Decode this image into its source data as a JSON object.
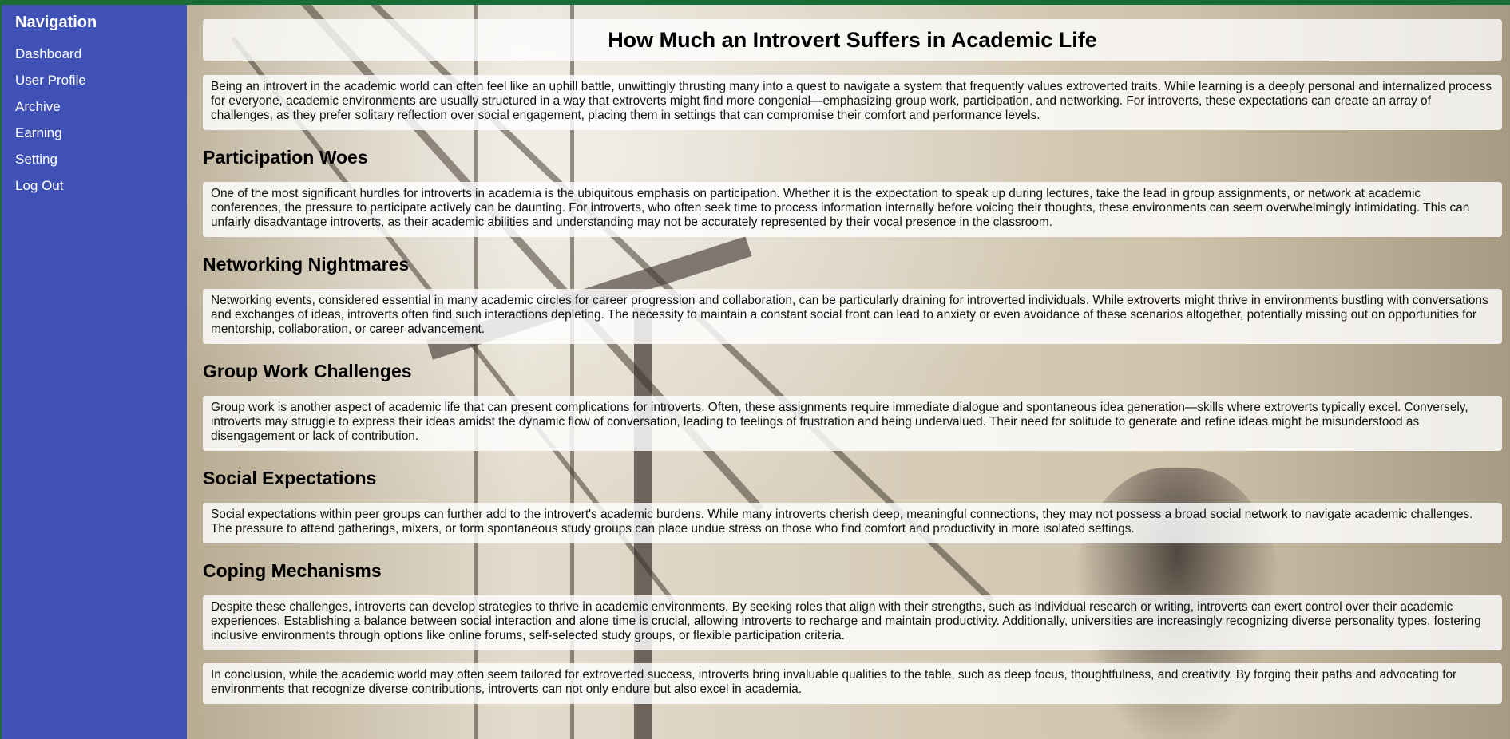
{
  "sidebar": {
    "title": "Navigation",
    "items": [
      {
        "label": "Dashboard"
      },
      {
        "label": "User Profile"
      },
      {
        "label": "Archive"
      },
      {
        "label": "Earning"
      },
      {
        "label": "Setting"
      },
      {
        "label": "Log Out"
      }
    ]
  },
  "article": {
    "title": "How Much an Introvert Suffers in Academic Life",
    "intro": "Being an introvert in the academic world can often feel like an uphill battle, unwittingly thrusting many into a quest to navigate a system that frequently values extroverted traits. While learning is a deeply personal and internalized process for everyone, academic environments are usually structured in a way that extroverts might find more congenial—emphasizing group work, participation, and networking. For introverts, these expectations can create an array of challenges, as they prefer solitary reflection over social engagement, placing them in settings that can compromise their comfort and performance levels.",
    "sections": [
      {
        "heading": "Participation Woes",
        "text": "One of the most significant hurdles for introverts in academia is the ubiquitous emphasis on participation. Whether it is the expectation to speak up during lectures, take the lead in group assignments, or network at academic conferences, the pressure to participate actively can be daunting. For introverts, who often seek time to process information internally before voicing their thoughts, these environments can seem overwhelmingly intimidating. This can unfairly disadvantage introverts, as their academic abilities and understanding may not be accurately represented by their vocal presence in the classroom."
      },
      {
        "heading": "Networking Nightmares",
        "text": "Networking events, considered essential in many academic circles for career progression and collaboration, can be particularly draining for introverted individuals. While extroverts might thrive in environments bustling with conversations and exchanges of ideas, introverts often find such interactions depleting. The necessity to maintain a constant social front can lead to anxiety or even avoidance of these scenarios altogether, potentially missing out on opportunities for mentorship, collaboration, or career advancement."
      },
      {
        "heading": "Group Work Challenges",
        "text": "Group work is another aspect of academic life that can present complications for introverts. Often, these assignments require immediate dialogue and spontaneous idea generation—skills where extroverts typically excel. Conversely, introverts may struggle to express their ideas amidst the dynamic flow of conversation, leading to feelings of frustration and being undervalued. Their need for solitude to generate and refine ideas might be misunderstood as disengagement or lack of contribution."
      },
      {
        "heading": "Social Expectations",
        "text": "Social expectations within peer groups can further add to the introvert's academic burdens. While many introverts cherish deep, meaningful connections, they may not possess a broad social network to navigate academic challenges. The pressure to attend gatherings, mixers, or form spontaneous study groups can place undue stress on those who find comfort and productivity in more isolated settings."
      },
      {
        "heading": "Coping Mechanisms",
        "text": "Despite these challenges, introverts can develop strategies to thrive in academic environments. By seeking roles that align with their strengths, such as individual research or writing, introverts can exert control over their academic experiences. Establishing a balance between social interaction and alone time is crucial, allowing introverts to recharge and maintain productivity. Additionally, universities are increasingly recognizing diverse personality types, fostering inclusive environments through options like online forums, self-selected study groups, or flexible participation criteria."
      }
    ],
    "conclusion": "In conclusion, while the academic world may often seem tailored for extroverted success, introverts bring invaluable qualities to the table, such as deep focus, thoughtfulness, and creativity. By forging their paths and advocating for environments that recognize diverse contributions, introverts can not only endure but also excel in academia."
  },
  "colors": {
    "sidebar_bg": "#3f51b5",
    "frame_border": "#1a6b36",
    "panel_bg": "rgba(255,255,255,0.8)"
  }
}
